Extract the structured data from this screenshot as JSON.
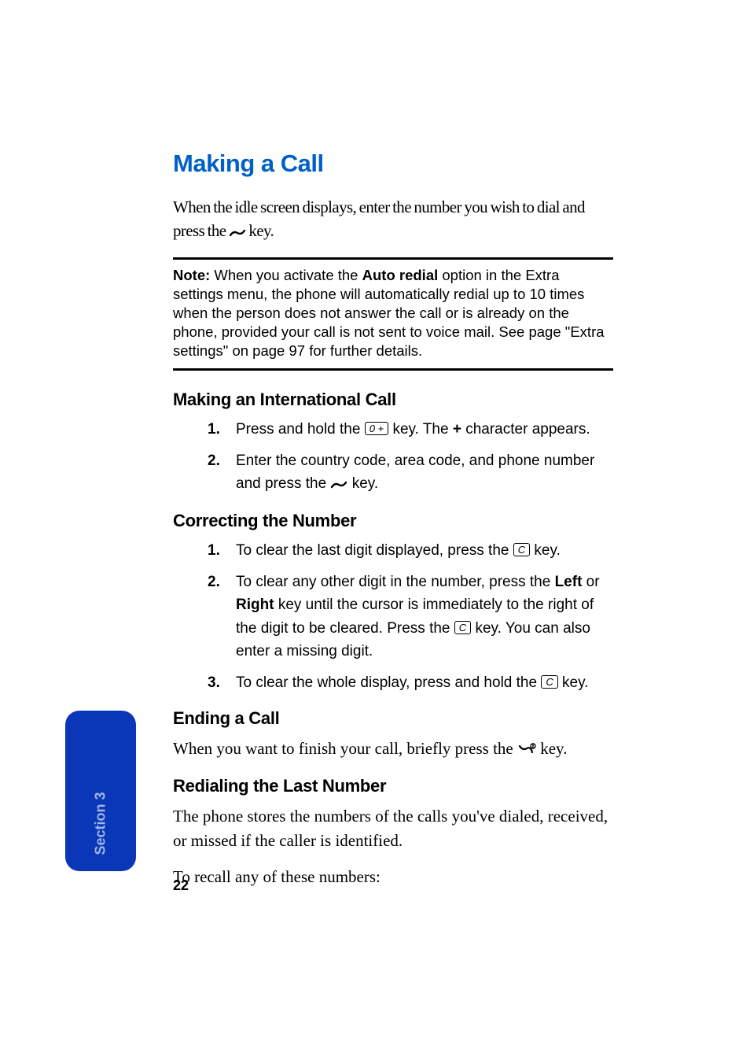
{
  "title": "Making a Call",
  "intro_a": "When the idle screen displays, enter the number you wish to dial and press the ",
  "intro_b": " key.",
  "note": {
    "label": "Note:",
    "a": " When you activate the ",
    "bold_option": "Auto redial",
    "b": " option in the Extra settings menu, the phone will automatically redial up to 10 times when the person does not answer the call or is already on the phone, provided your call is not sent to voice mail. See page \"Extra settings\" on page 97 for further details."
  },
  "sections": {
    "intl": {
      "heading": "Making an International Call",
      "steps": [
        {
          "num": "1.",
          "a": "Press and hold the ",
          "key": "0 +",
          "b": " key. The ",
          "bold": "+",
          "c": " character appears."
        },
        {
          "num": "2.",
          "a": "Enter the country code, area code, and phone number and press the ",
          "b": " key."
        }
      ]
    },
    "correct": {
      "heading": "Correcting the Number",
      "steps": [
        {
          "num": "1.",
          "a": "To clear the last digit displayed, press the ",
          "key": "C",
          "b": " key."
        },
        {
          "num": "2.",
          "a": "To clear any other digit in the number, press the ",
          "bold1": "Left",
          "b": " or ",
          "bold2": "Right",
          "c": " key until the cursor is immediately to the right of the digit to be cleared. Press the ",
          "key": "C",
          "d": " key. You can also enter a missing digit."
        },
        {
          "num": "3.",
          "a": "To clear the whole display, press and hold the ",
          "key": "C",
          "b": " key."
        }
      ]
    },
    "ending": {
      "heading": "Ending a Call",
      "body_a": "When you want to finish your call, briefly press the ",
      "body_b": " key."
    },
    "redial": {
      "heading": "Redialing the Last Number",
      "p1": "The phone stores the numbers of the calls you've dialed, received, or missed if the caller is identified.",
      "p2": "To recall any of these numbers:"
    }
  },
  "tab_label": "Section 3",
  "page_number": "22"
}
